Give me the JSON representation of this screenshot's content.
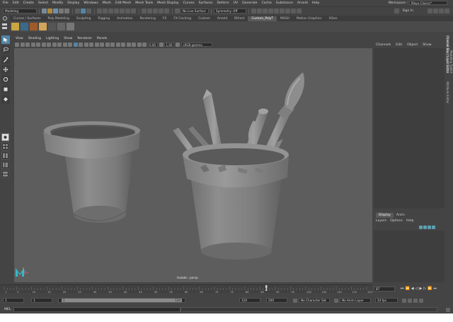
{
  "menubar": {
    "items": [
      "File",
      "Edit",
      "Create",
      "Select",
      "Modify",
      "Display",
      "Windows",
      "Mesh",
      "Edit Mesh",
      "Mesh Tools",
      "Mesh Display",
      "Curves",
      "Surfaces",
      "Deform",
      "UV",
      "Generate",
      "Cache",
      "Substance",
      "Arnold",
      "Help"
    ],
    "workspace_label": "Workspace :",
    "workspace_value": "Maya Classic*"
  },
  "statusline": {
    "mode": "Modeling",
    "live_surface": "No Live Surface",
    "symmetry": "Symmetry: Off",
    "sign_in": "Sign In"
  },
  "shelf": {
    "tabs": [
      "Curves / Surfaces",
      "Poly Modeling",
      "Sculpting",
      "Rigging",
      "Animation",
      "Rendering",
      "FX",
      "FX Caching",
      "Custom",
      "Arnold",
      "Bifrost",
      "Custom_PolyT",
      "MASH",
      "Motion Graphics",
      "XGen"
    ],
    "active_tab": "Custom_PolyT"
  },
  "viewport": {
    "menu": [
      "View",
      "Shading",
      "Lighting",
      "Show",
      "Renderer",
      "Panels"
    ],
    "near_value": "0.00",
    "far_value": "1.00",
    "color_space": "sRGB gamma",
    "camera_label": "Isolate : persp"
  },
  "channel_box": {
    "menu": [
      "Channels",
      "Edit",
      "Object",
      "Show"
    ]
  },
  "side_tabs": [
    "Channel Box / Layer Editor",
    "Modeling Toolkit",
    "Attribute Editor"
  ],
  "layer_editor": {
    "tabs": [
      "Display",
      "Anim"
    ],
    "active_tab": "Display",
    "menu": [
      "Layers",
      "Options",
      "Help"
    ]
  },
  "timeline": {
    "ticks": [
      "1",
      "5",
      "10",
      "15",
      "20",
      "25",
      "30",
      "35",
      "40",
      "45",
      "50",
      "55",
      "60",
      "65",
      "70",
      "75",
      "80",
      "85",
      "90",
      "95",
      "100",
      "105",
      "110",
      "115",
      "120"
    ],
    "current_frame": "87",
    "current_frame_field": "87"
  },
  "range": {
    "start": "1",
    "start_inner": "1",
    "slider_start": "1",
    "slider_end": "120",
    "end_inner": "120",
    "end": "200",
    "character_set": "No Character Set",
    "anim_layer": "No Anim Layer",
    "fps": "24 fps"
  },
  "command_line": {
    "label": "MEL"
  }
}
